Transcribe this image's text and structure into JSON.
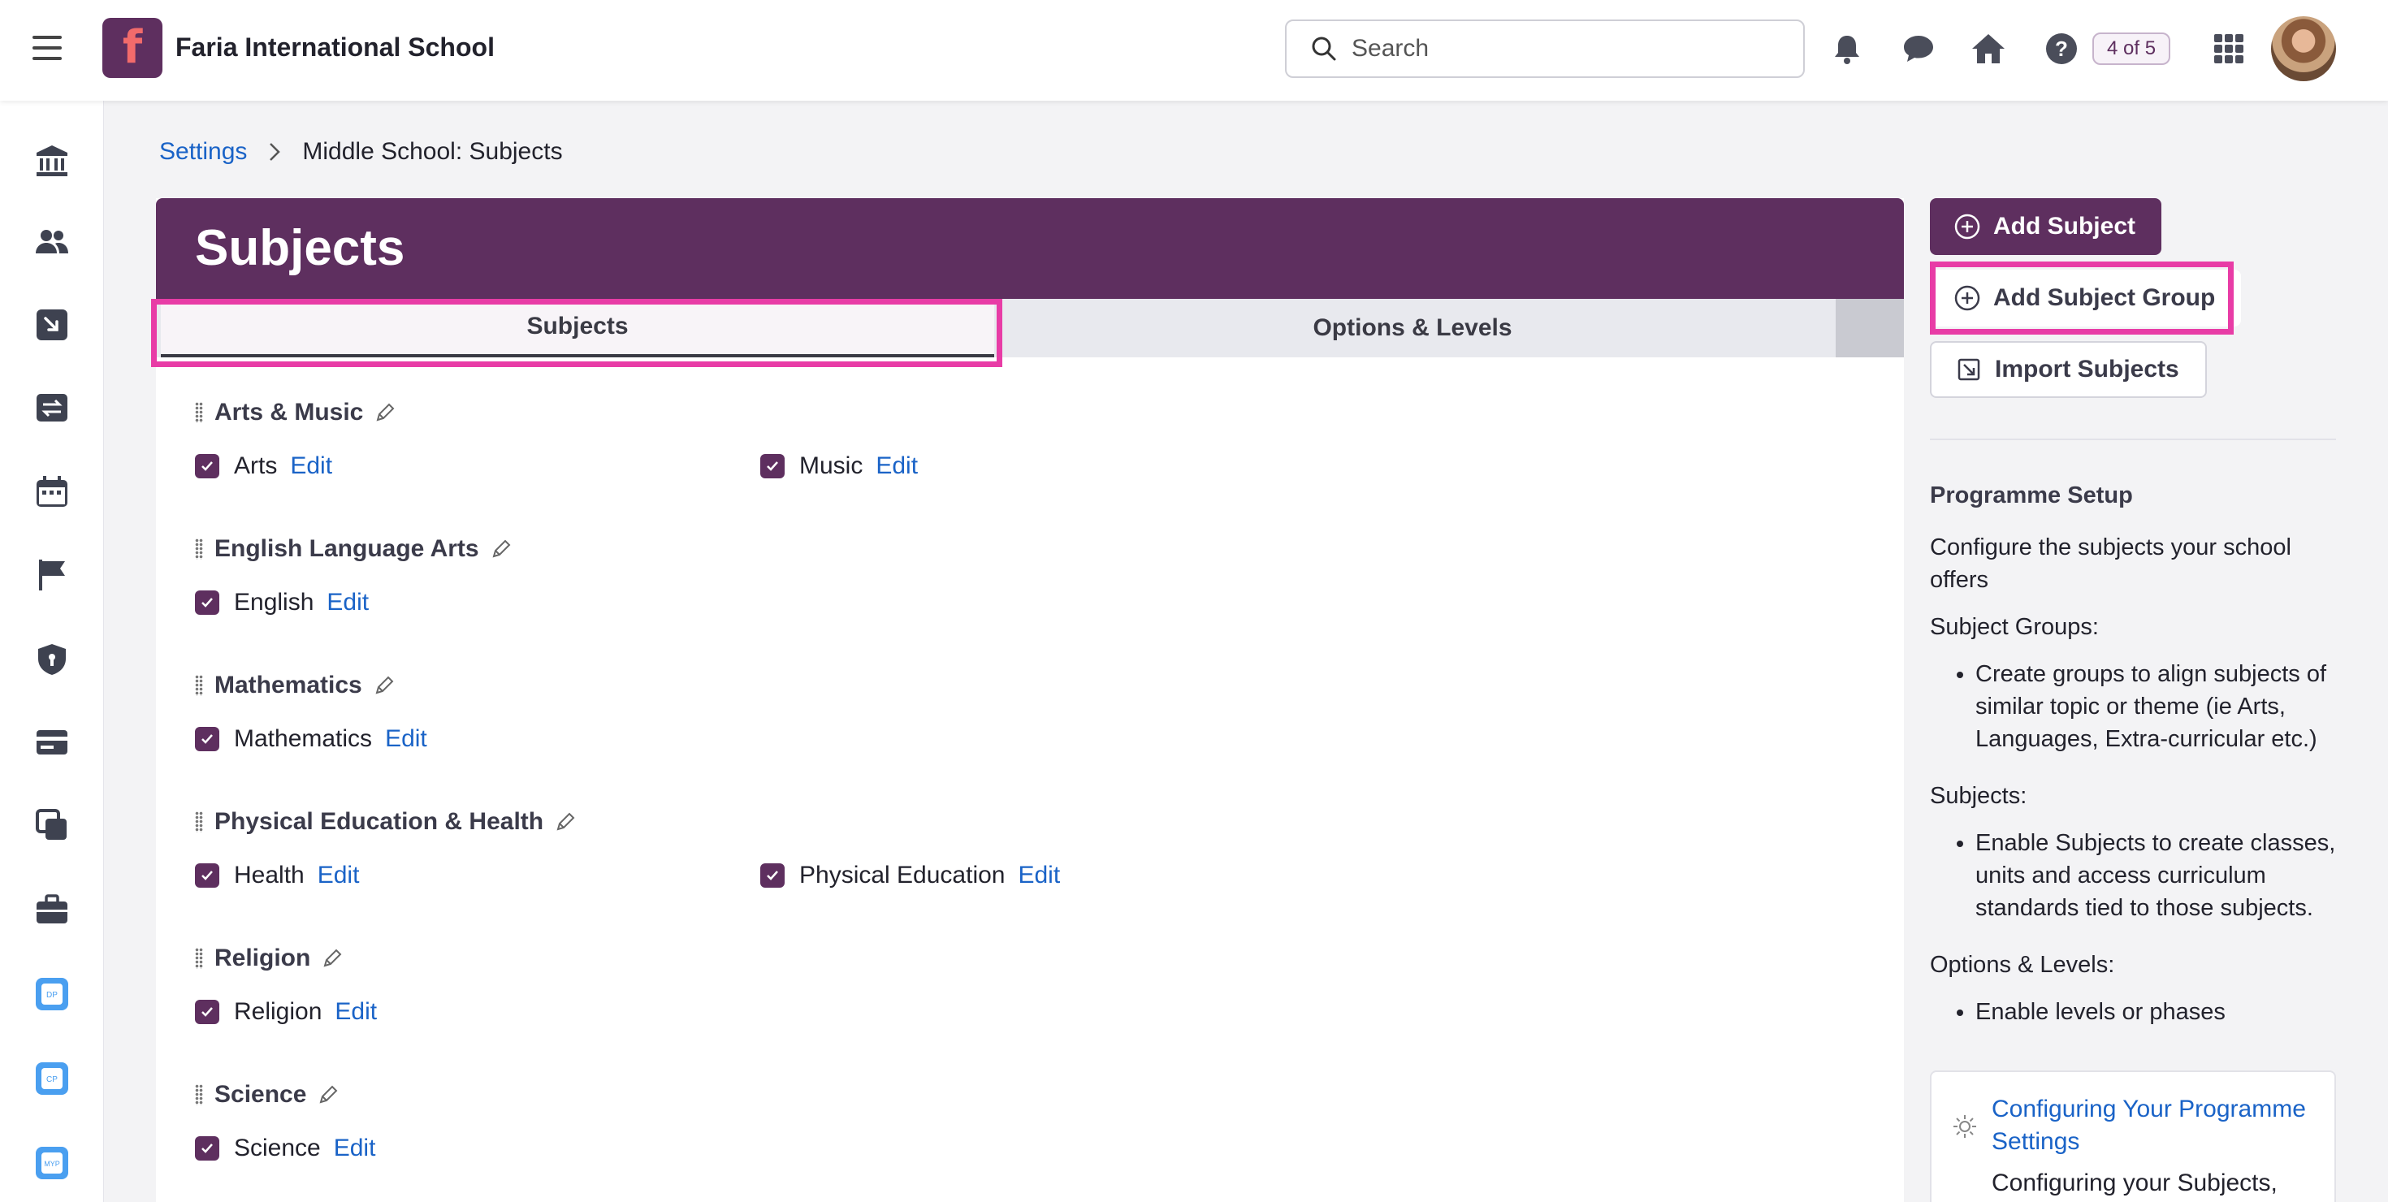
{
  "header": {
    "school_name": "Faria International School",
    "search_placeholder": "Search",
    "badge": "4 of 5"
  },
  "breadcrumb": {
    "root": "Settings",
    "current": "Middle School: Subjects"
  },
  "page": {
    "title": "Subjects"
  },
  "tabs": [
    {
      "label": "Subjects",
      "active": true
    },
    {
      "label": "Options & Levels",
      "active": false
    }
  ],
  "groups": [
    {
      "name": "Arts & Music",
      "subjects": [
        {
          "label": "Arts",
          "edit": "Edit"
        },
        {
          "label": "Music",
          "edit": "Edit"
        }
      ]
    },
    {
      "name": "English Language Arts",
      "subjects": [
        {
          "label": "English",
          "edit": "Edit"
        }
      ]
    },
    {
      "name": "Mathematics",
      "subjects": [
        {
          "label": "Mathematics",
          "edit": "Edit"
        }
      ]
    },
    {
      "name": "Physical Education & Health",
      "subjects": [
        {
          "label": "Health",
          "edit": "Edit"
        },
        {
          "label": "Physical Education",
          "edit": "Edit"
        }
      ]
    },
    {
      "name": "Religion",
      "subjects": [
        {
          "label": "Religion",
          "edit": "Edit"
        }
      ]
    },
    {
      "name": "Science",
      "subjects": [
        {
          "label": "Science",
          "edit": "Edit"
        }
      ]
    }
  ],
  "actions": {
    "add_subject": "Add Subject",
    "add_subject_group": "Add Subject Group",
    "import_subjects": "Import Subjects"
  },
  "sidebar": {
    "heading": "Programme Setup",
    "intro": "Configure the subjects your school offers",
    "sections": [
      {
        "title": "Subject Groups:",
        "bullets": [
          "Create groups to align subjects of similar topic or theme (ie Arts, Languages, Extra-curricular etc.)"
        ]
      },
      {
        "title": "Subjects:",
        "bullets": [
          "Enable Subjects to create classes, units and access curriculum standards tied to those subjects."
        ]
      },
      {
        "title": "Options & Levels:",
        "bullets": [
          "Enable levels or phases"
        ]
      }
    ],
    "help_link": "Configuring Your Programme Settings",
    "help_text": "Configuring your Subjects,"
  },
  "colors": {
    "brand": "#5e2f5f",
    "link": "#1a63c7",
    "highlight": "#e83ca6"
  },
  "rail_icons": [
    "institution-icon",
    "users-icon",
    "import-icon",
    "transfer-icon",
    "calendar-icon",
    "flag-icon",
    "shield-icon",
    "card-icon",
    "copy-icon",
    "briefcase-icon",
    "dp-app-icon",
    "cp-app-icon",
    "myp-app-icon"
  ]
}
